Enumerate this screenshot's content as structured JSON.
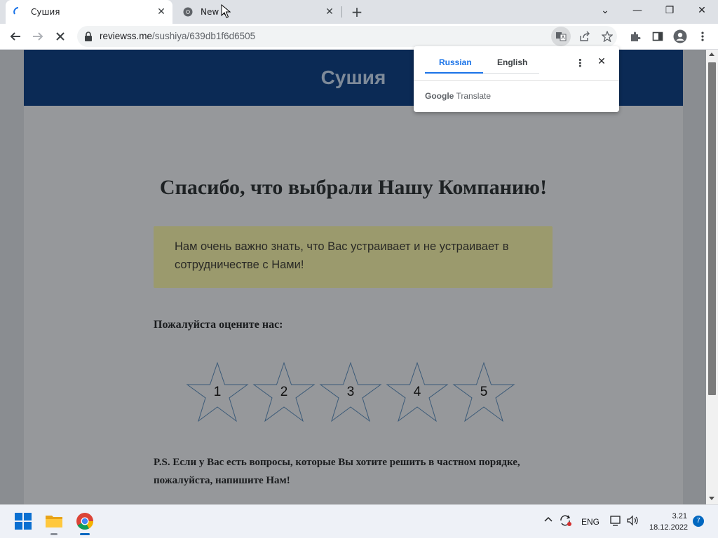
{
  "browser": {
    "tabs": [
      {
        "title": "Сушия",
        "close": "✕"
      },
      {
        "title": "New T",
        "close": "✕"
      }
    ],
    "new_tab_label": "+",
    "window_controls": {
      "collapse": "⌄",
      "minimize": "—",
      "restore": "❐",
      "close": "✕"
    },
    "url_domain": "reviewss.me",
    "url_path": "/sushiya/639db1f6d6505"
  },
  "translate_bubble": {
    "tab_source": "Russian",
    "tab_target": "English",
    "brand_google": "Google",
    "brand_translate": "Translate",
    "more": "⋮",
    "close": "✕"
  },
  "page": {
    "brand": "Сушия",
    "heading": "Спасибо, что выбрали Нашу Компанию!",
    "notice": "Нам очень важно знать, что Вас устраивает и не устраивает в сотрудничестве с Нами!",
    "rate_prompt": "Пожалуйста оцените нас:",
    "stars": [
      "1",
      "2",
      "3",
      "4",
      "5"
    ],
    "ps": "P.S. Если у Вас есть вопросы, которые Вы хотите решить в частном порядке, пожалуйста, напишите Нам!"
  },
  "taskbar": {
    "language": "ENG",
    "time": "3.21",
    "date": "18.12.2022",
    "notification_count": "7"
  },
  "colors": {
    "site_header": "#0b2a55",
    "notice_bg": "#9b9a6d",
    "accent_blue": "#1a73e8"
  }
}
